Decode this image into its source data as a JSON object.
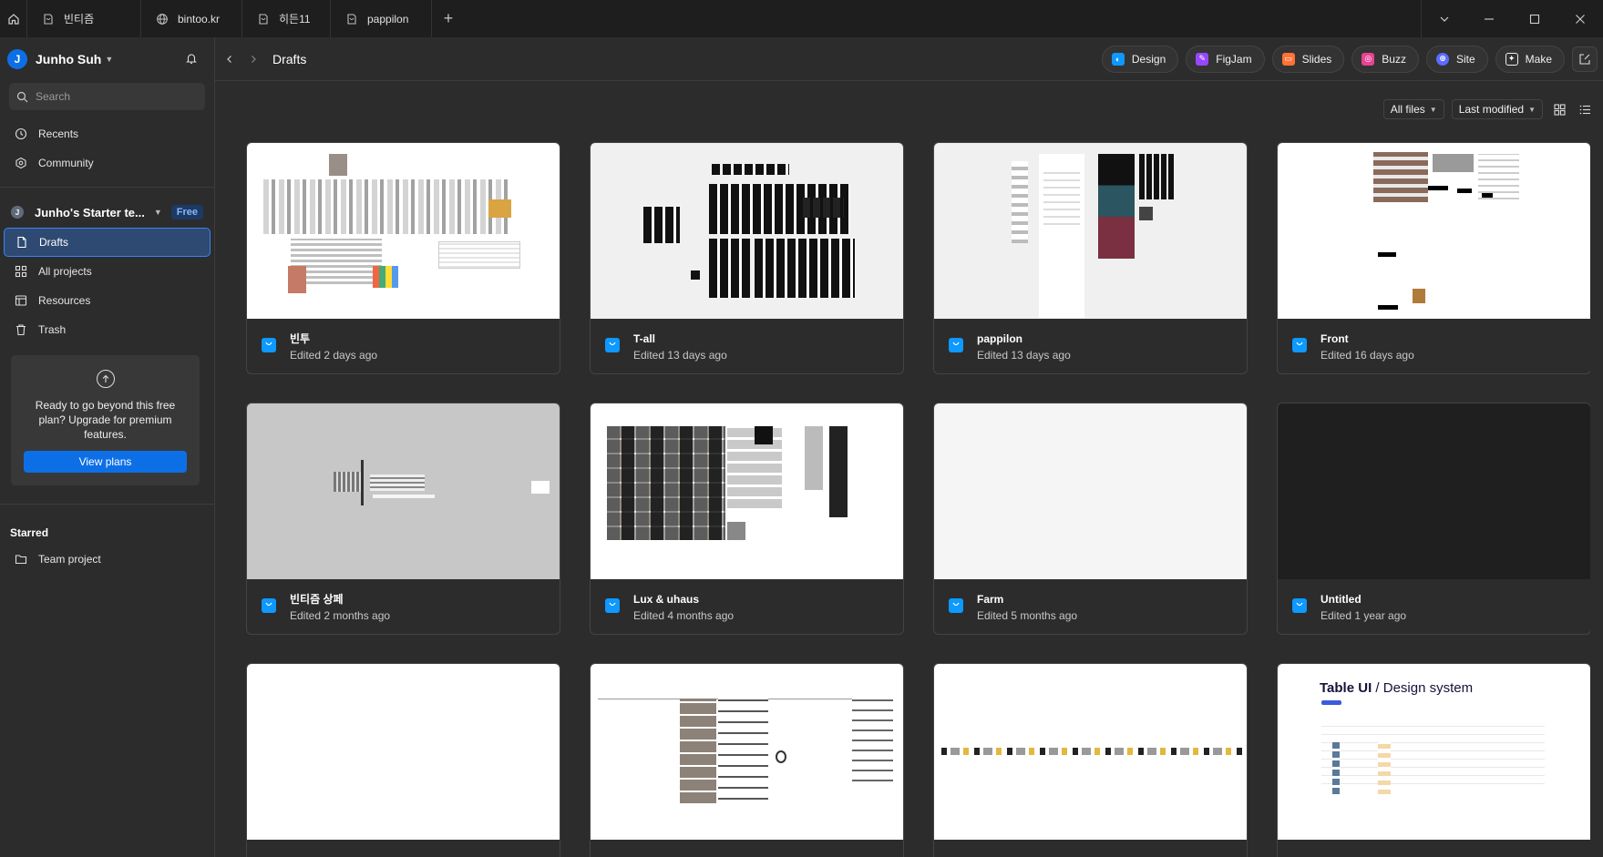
{
  "tabs": [
    {
      "label": "빈티즘",
      "icon": "figma-file-icon"
    },
    {
      "label": "bintoo.kr",
      "icon": "globe-icon"
    },
    {
      "label": "히든11",
      "icon": "figma-file-icon"
    },
    {
      "label": "pappilon",
      "icon": "figma-file-icon"
    }
  ],
  "sidebar": {
    "avatar_letter": "J",
    "user_name": "Junho Suh",
    "search_placeholder": "Search",
    "top_items": [
      {
        "label": "Recents",
        "icon": "clock-icon"
      },
      {
        "label": "Community",
        "icon": "community-icon"
      }
    ],
    "team": {
      "avatar_letter": "J",
      "name": "Junho's Starter te...",
      "badge": "Free"
    },
    "team_items": [
      {
        "label": "Drafts",
        "icon": "file-icon",
        "active": true
      },
      {
        "label": "All projects",
        "icon": "grid-icon"
      },
      {
        "label": "Resources",
        "icon": "resources-icon"
      },
      {
        "label": "Trash",
        "icon": "trash-icon"
      }
    ],
    "upgrade": {
      "text": "Ready to go beyond this free plan? Upgrade for premium features.",
      "button": "View plans"
    },
    "starred_heading": "Starred",
    "starred_items": [
      {
        "label": "Team project",
        "icon": "folder-icon"
      }
    ]
  },
  "header": {
    "breadcrumb": "Drafts",
    "create": [
      {
        "label": "Design",
        "color": "#0d99ff"
      },
      {
        "label": "FigJam",
        "color": "#9747ff"
      },
      {
        "label": "Slides",
        "color": "#ff7237"
      },
      {
        "label": "Buzz",
        "color": "#e84393"
      },
      {
        "label": "Site",
        "color": "#5b6cff"
      },
      {
        "label": "Make",
        "color": "#ffffff"
      }
    ]
  },
  "filters": {
    "scope": "All files",
    "sort": "Last modified"
  },
  "files": [
    {
      "name": "빈투",
      "edited": "Edited 2 days ago"
    },
    {
      "name": "T-all",
      "edited": "Edited 13 days ago"
    },
    {
      "name": "pappilon",
      "edited": "Edited 13 days ago"
    },
    {
      "name": "Front",
      "edited": "Edited 16 days ago"
    },
    {
      "name": "빈티즘 상페",
      "edited": "Edited 2 months ago"
    },
    {
      "name": "Lux & uhaus",
      "edited": "Edited 4 months ago"
    },
    {
      "name": "Farm",
      "edited": "Edited 5 months ago"
    },
    {
      "name": "Untitled",
      "edited": "Edited 1 year ago"
    },
    {
      "name": "",
      "edited": ""
    },
    {
      "name": "",
      "edited": ""
    },
    {
      "name": "",
      "edited": ""
    },
    {
      "name": "",
      "edited": ""
    }
  ],
  "table_ui_thumb": {
    "title_bold": "Table UI",
    "title_rest": " / Design system"
  }
}
